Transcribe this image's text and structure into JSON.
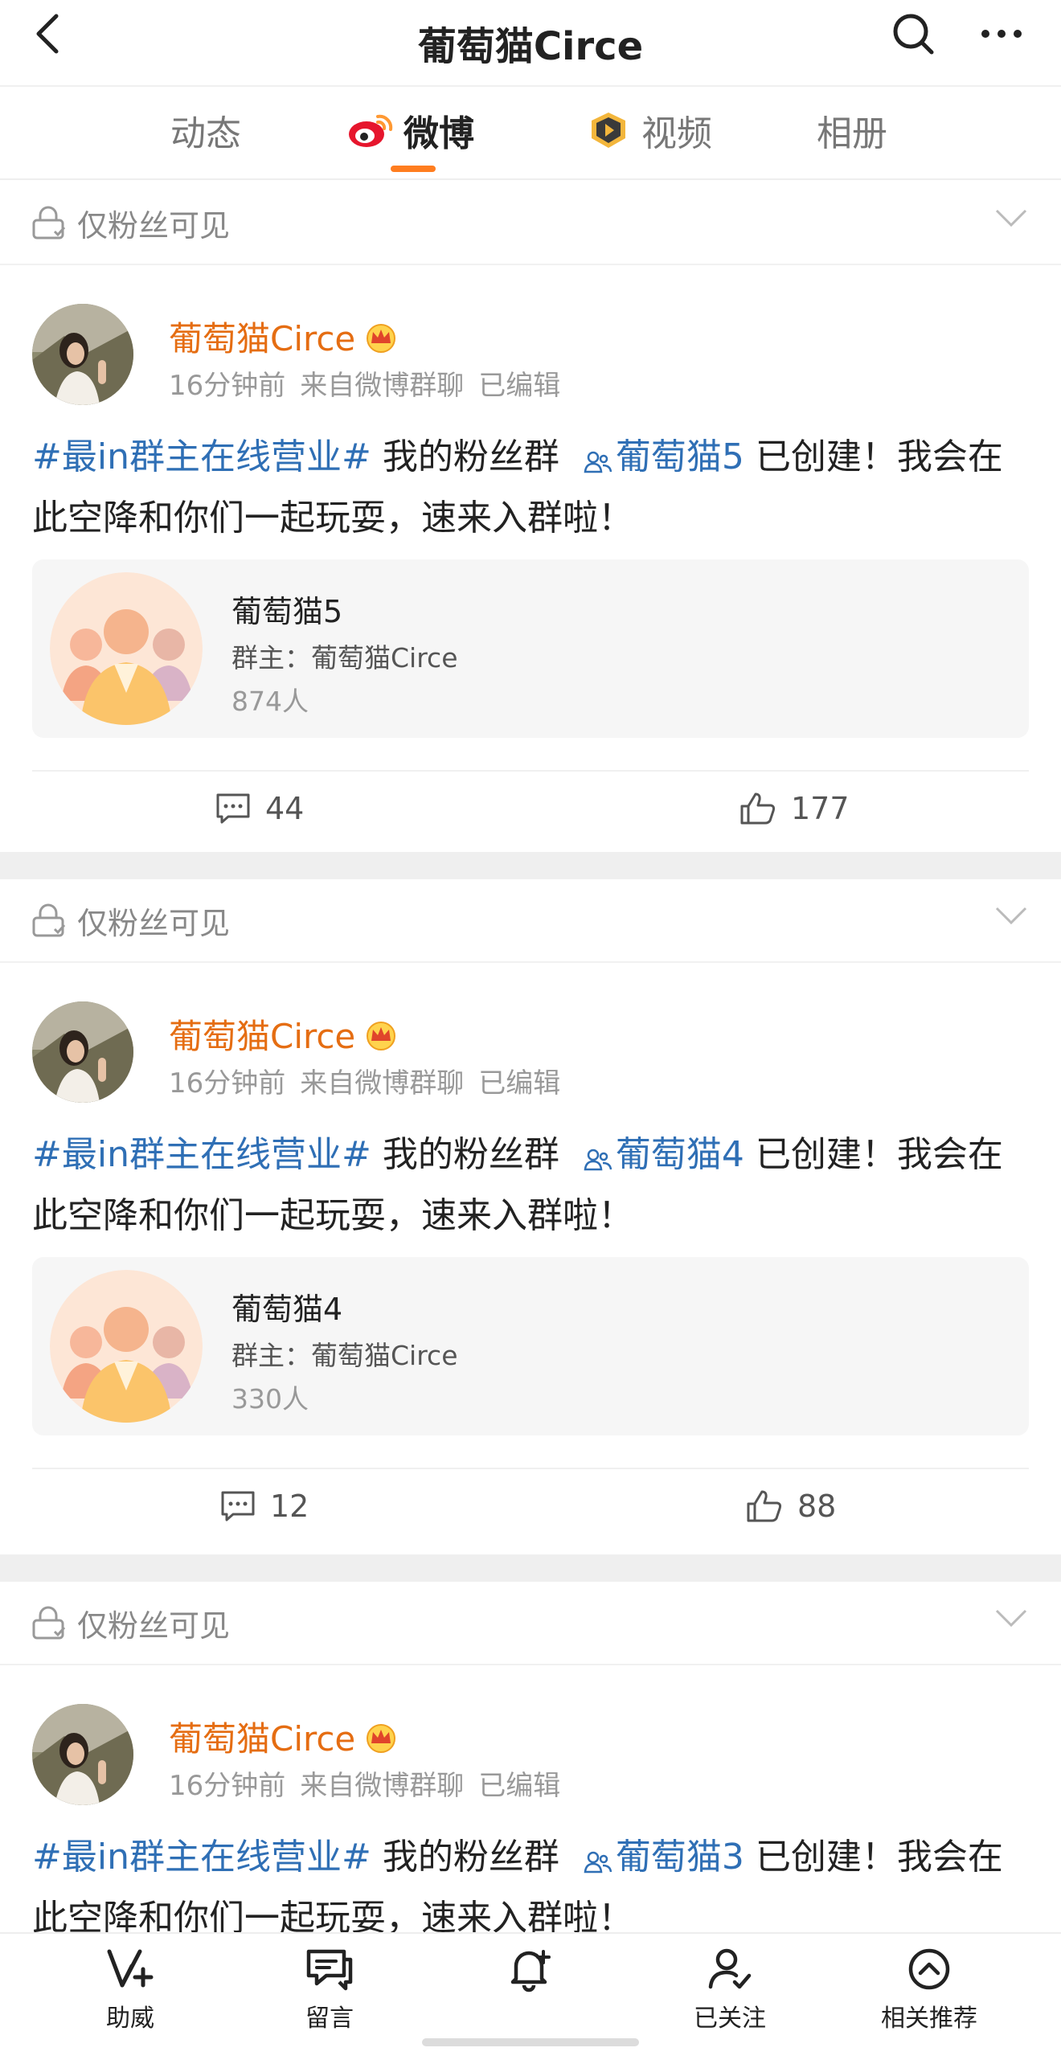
{
  "header": {
    "title": "葡萄猫Circe"
  },
  "tabs": [
    {
      "label": "动态",
      "active": false
    },
    {
      "label": "微博",
      "active": true
    },
    {
      "label": "视频",
      "active": false
    },
    {
      "label": "相册",
      "active": false
    }
  ],
  "colors": {
    "accent": "#ff7d1f",
    "username": "#e56d12",
    "link": "#2f6fb5"
  },
  "posts": [
    {
      "visibility": "仅粉丝可见",
      "author": "葡萄猫Circe",
      "time": "16分钟前",
      "source": "来自微博群聊",
      "edited": "已编辑",
      "topic": "#最in群主在线营业#",
      "text_before": " 我的粉丝群 ",
      "group_link": "葡萄猫5",
      "text_after": " 已创建！我会在此空降和你们一起玩耍，速来入群啦！",
      "group_card": {
        "name": "葡萄猫5",
        "owner": "群主：葡萄猫Circe",
        "members": "874人"
      },
      "comments": "44",
      "likes": "177"
    },
    {
      "visibility": "仅粉丝可见",
      "author": "葡萄猫Circe",
      "time": "16分钟前",
      "source": "来自微博群聊",
      "edited": "已编辑",
      "topic": "#最in群主在线营业#",
      "text_before": " 我的粉丝群 ",
      "group_link": "葡萄猫4",
      "text_after": " 已创建！我会在此空降和你们一起玩耍，速来入群啦！",
      "group_card": {
        "name": "葡萄猫4",
        "owner": "群主：葡萄猫Circe",
        "members": "330人"
      },
      "comments": "12",
      "likes": "88"
    },
    {
      "visibility": "仅粉丝可见",
      "author": "葡萄猫Circe",
      "time": "16分钟前",
      "source": "来自微博群聊",
      "edited": "已编辑",
      "topic": "#最in群主在线营业#",
      "text_before": " 我的粉丝群 ",
      "group_link": "葡萄猫3",
      "text_after": " 已创建！我会在此空降和你们一起玩耍，速来入群啦！"
    }
  ],
  "bottom_nav": [
    {
      "label": "助威",
      "icon": "cheer-v-plus-icon"
    },
    {
      "label": "留言",
      "icon": "message-bubble-icon"
    },
    {
      "label": "",
      "icon": "bell-plus-icon"
    },
    {
      "label": "已关注",
      "icon": "user-check-icon"
    },
    {
      "label": "相关推荐",
      "icon": "chevron-up-circle-icon"
    }
  ]
}
